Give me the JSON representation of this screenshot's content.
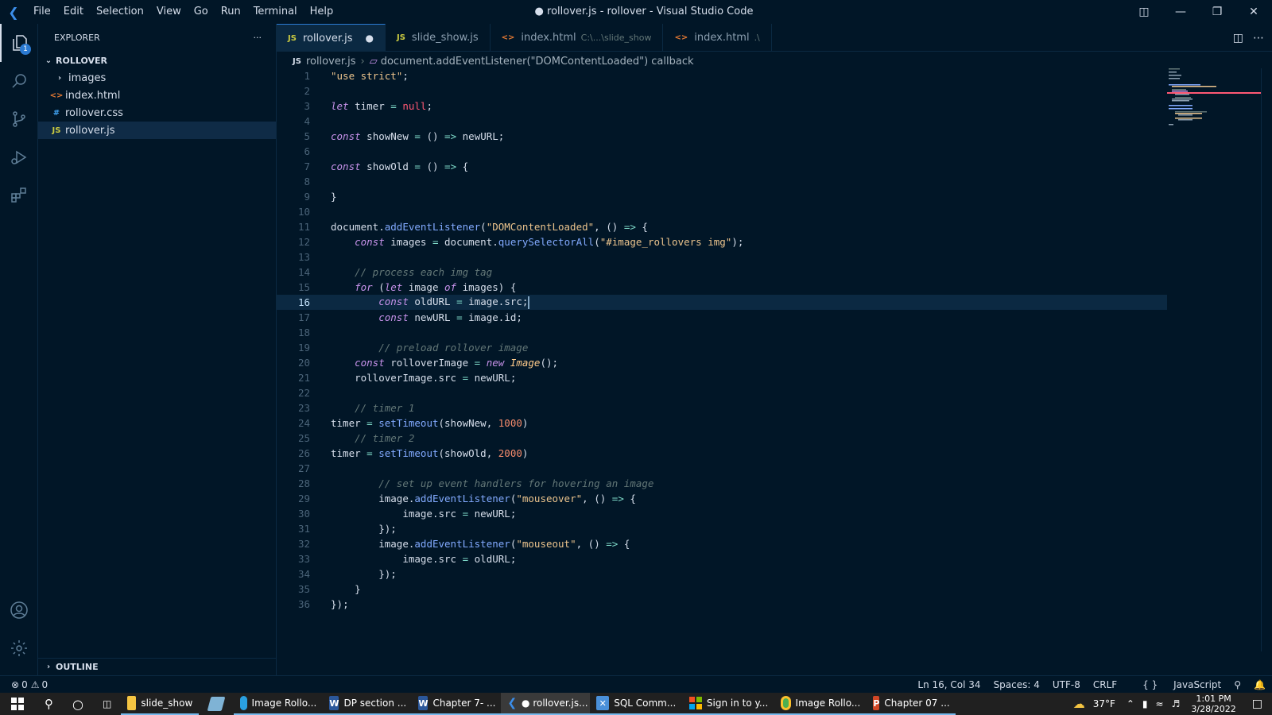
{
  "window": {
    "title": "● rollover.js - rollover - Visual Studio Code",
    "menu": [
      "File",
      "Edit",
      "Selection",
      "View",
      "Go",
      "Run",
      "Terminal",
      "Help"
    ]
  },
  "activity_bar": {
    "items": [
      "explorer-icon",
      "search-icon",
      "source-control-icon",
      "run-debug-icon",
      "extensions-icon"
    ],
    "explorer_badge": "1",
    "bottom": [
      "account-icon",
      "settings-gear-icon"
    ]
  },
  "sidebar": {
    "title": "EXPLORER",
    "more": "···",
    "folder": "ROLLOVER",
    "items": [
      {
        "label": "images",
        "icon": "›",
        "type": "folder"
      },
      {
        "label": "index.html",
        "icon": "<>",
        "type": "html"
      },
      {
        "label": "rollover.css",
        "icon": "#",
        "type": "css"
      },
      {
        "label": "rollover.js",
        "icon": "JS",
        "type": "js"
      }
    ],
    "outline": "OUTLINE"
  },
  "tabs": [
    {
      "label": "rollover.js",
      "icon": "JS",
      "description": "",
      "modified": "●"
    },
    {
      "label": "slide_show.js",
      "icon": "JS",
      "description": "",
      "modified": ""
    },
    {
      "label": "index.html",
      "icon": "<>",
      "description": "C:\\...\\slide_show",
      "modified": ""
    },
    {
      "label": "index.html",
      "icon": "<>",
      "description": ".\\",
      "modified": ""
    }
  ],
  "breadcrumb": {
    "file_icon": "JS",
    "file": "rollover.js",
    "symbol": "document.addEventListener(\"DOMContentLoaded\") callback"
  },
  "editor": {
    "current_line": 16,
    "lines": [
      "\"use strict\";",
      "",
      "let timer = null;",
      "",
      "const showNew = () => newURL;",
      "",
      "const showOld = () => {",
      "",
      "}",
      "",
      "document.addEventListener(\"DOMContentLoaded\", () => {",
      "    const images = document.querySelectorAll(\"#image_rollovers img\");",
      "",
      "    // process each img tag",
      "    for (let image of images) {",
      "        const oldURL = image.src;",
      "        const newURL = image.id;",
      "",
      "        // preload rollover image",
      "    const rolloverImage = new Image();",
      "    rolloverImage.src = newURL;",
      "",
      "    // timer 1",
      "timer = setTimeout(showNew, 1000)",
      "    // timer 2",
      "timer = setTimeout(showOld, 2000)",
      "",
      "        // set up event handlers for hovering an image",
      "        image.addEventListener(\"mouseover\", () => {",
      "            image.src = newURL;",
      "        });",
      "        image.addEventListener(\"mouseout\", () => {",
      "            image.src = oldURL;",
      "        });",
      "    }",
      "});"
    ]
  },
  "status": {
    "errors": "0",
    "warnings": "0",
    "position": "Ln 16, Col 34",
    "spaces": "Spaces: 4",
    "encoding": "UTF-8",
    "eol": "CRLF",
    "language": "JavaScript"
  },
  "taskbar": {
    "items": [
      {
        "label": "slide_show",
        "icon": "folder-icon",
        "color": "#f5c542"
      },
      {
        "label": "",
        "icon": "notepad-icon",
        "color": "#7fb3d5"
      },
      {
        "label": "Image Rollo...",
        "icon": "edge-icon",
        "color": "#2aa0e0"
      },
      {
        "label": "DP section ...",
        "icon": "word-icon",
        "color": "#2b579a"
      },
      {
        "label": "Chapter 7- ...",
        "icon": "word-icon",
        "color": "#2b579a"
      },
      {
        "label": "● rollover.js...",
        "icon": "vscode-icon",
        "color": "#3b8eea"
      },
      {
        "label": "SQL Comm...",
        "icon": "sql-icon",
        "color": "#4a90d9"
      },
      {
        "label": "Sign in to y...",
        "icon": "microsoft-icon",
        "color": "#f25022"
      },
      {
        "label": "Image Rollo...",
        "icon": "chrome-icon",
        "color": "#4caf50"
      },
      {
        "label": "Chapter 07 ...",
        "icon": "powerpoint-icon",
        "color": "#d24726"
      }
    ],
    "weather": "37°F",
    "time": "1:01 PM",
    "date": "3/28/2022"
  },
  "colors": {
    "background": "#011627",
    "accent": "#2b7ad2",
    "current_line": "#0b2942",
    "taskbar": "#202020"
  }
}
